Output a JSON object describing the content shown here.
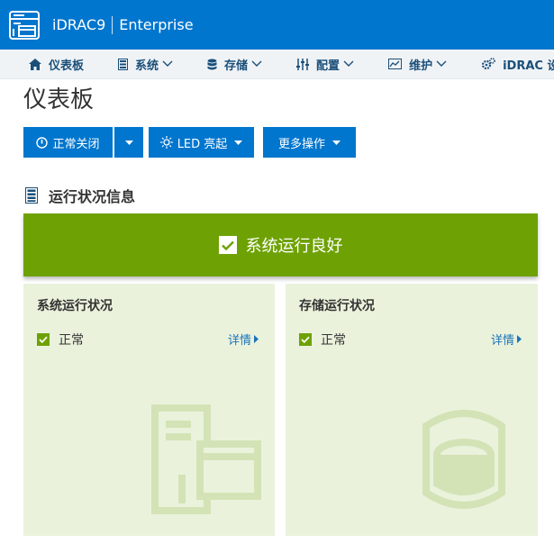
{
  "header": {
    "product": "iDRAC9",
    "edition": "Enterprise",
    "logo_icon": "server-icon"
  },
  "nav": {
    "items": [
      {
        "label": "仪表板",
        "icon": "home-icon"
      },
      {
        "label": "系统",
        "icon": "server-list-icon"
      },
      {
        "label": "存储",
        "icon": "database-icon"
      },
      {
        "label": "配置",
        "icon": "sliders-icon"
      },
      {
        "label": "维护",
        "icon": "chart-icon"
      },
      {
        "label": "iDRAC 设",
        "icon": "gears-icon"
      }
    ]
  },
  "page": {
    "title": "仪表板"
  },
  "actions": {
    "power_label": "正常关闭",
    "led_label": "LED 亮起",
    "more_label": "更多操作"
  },
  "health": {
    "section_title": "运行状况信息",
    "banner_text": "系统运行良好",
    "cards": [
      {
        "title": "系统运行状况",
        "status": "正常",
        "link": "详情",
        "watermark": "server-watermark-icon"
      },
      {
        "title": "存储运行状况",
        "status": "正常",
        "link": "详情",
        "watermark": "disk-watermark-icon"
      }
    ]
  },
  "colors": {
    "brand_blue": "#0076ce",
    "ok_green": "#6ea204",
    "card_bg": "#eaf2dc",
    "nav_text": "#1a4f7a"
  }
}
